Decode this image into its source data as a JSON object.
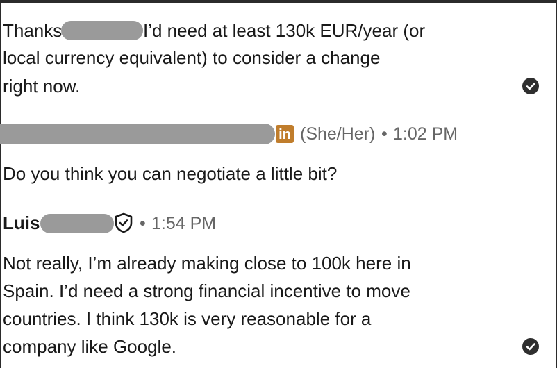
{
  "messages": [
    {
      "lines": [
        "Thanks",
        "I’d need at least 130k EUR/year (or",
        "local currency equivalent) to consider a change",
        "right now."
      ],
      "status_icon": "read-check-icon"
    },
    {
      "sender_pronouns": "(She/Her)",
      "separator": "•",
      "time": "1:02 PM",
      "lines": [
        "Do you think you can negotiate a little bit?"
      ],
      "badge": "in"
    },
    {
      "sender_name": "Luis",
      "separator": "•",
      "time": "1:54 PM",
      "lines": [
        "Not really, I’m already making close to 100k here in",
        "Spain. I’d need a strong financial incentive to move",
        "countries. I think 130k is very reasonable for a",
        "company like Google."
      ],
      "status_icon": "read-check-icon",
      "verified_icon": "verified-shield-icon"
    }
  ],
  "colors": {
    "text": "#191919",
    "meta": "#666666",
    "redaction": "#9a9a9a",
    "linkedin_badge": "#c07d2c",
    "check": "#2f2f2f"
  }
}
